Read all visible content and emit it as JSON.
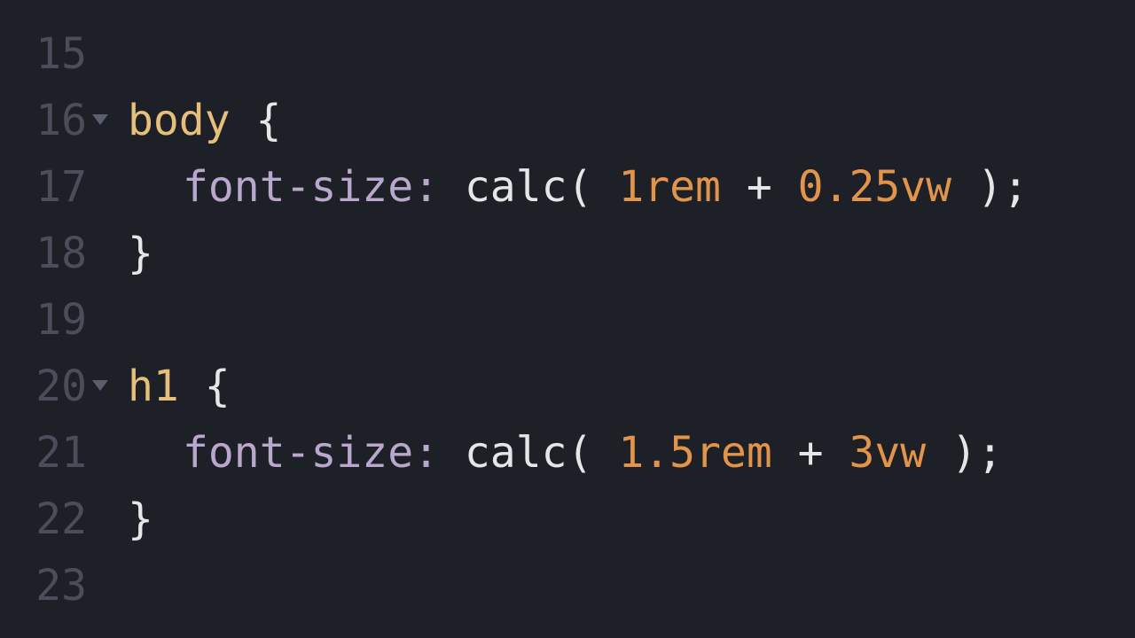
{
  "editor": {
    "language": "css",
    "lines": [
      {
        "num": "15",
        "foldable": false,
        "indent": 0,
        "tokens": []
      },
      {
        "num": "16",
        "foldable": true,
        "indent": 0,
        "tokens": [
          {
            "t": "selector",
            "v": "body"
          },
          {
            "t": "space",
            "v": " "
          },
          {
            "t": "brace",
            "v": "{"
          }
        ]
      },
      {
        "num": "17",
        "foldable": false,
        "indent": 1,
        "tokens": [
          {
            "t": "property",
            "v": "font-size"
          },
          {
            "t": "colon",
            "v": ":"
          },
          {
            "t": "space",
            "v": " "
          },
          {
            "t": "func",
            "v": "calc"
          },
          {
            "t": "paren",
            "v": "("
          },
          {
            "t": "space",
            "v": " "
          },
          {
            "t": "number",
            "v": "1"
          },
          {
            "t": "unit",
            "v": "rem"
          },
          {
            "t": "space",
            "v": " "
          },
          {
            "t": "op",
            "v": "+"
          },
          {
            "t": "space",
            "v": " "
          },
          {
            "t": "number",
            "v": "0.25"
          },
          {
            "t": "unit",
            "v": "vw"
          },
          {
            "t": "space",
            "v": " "
          },
          {
            "t": "paren",
            "v": ")"
          },
          {
            "t": "semi",
            "v": ";"
          }
        ]
      },
      {
        "num": "18",
        "foldable": false,
        "indent": 0,
        "tokens": [
          {
            "t": "brace",
            "v": "}"
          }
        ]
      },
      {
        "num": "19",
        "foldable": false,
        "indent": 0,
        "tokens": []
      },
      {
        "num": "20",
        "foldable": true,
        "indent": 0,
        "tokens": [
          {
            "t": "selector",
            "v": "h1"
          },
          {
            "t": "space",
            "v": " "
          },
          {
            "t": "brace",
            "v": "{"
          }
        ]
      },
      {
        "num": "21",
        "foldable": false,
        "indent": 1,
        "tokens": [
          {
            "t": "property",
            "v": "font-size"
          },
          {
            "t": "colon",
            "v": ":"
          },
          {
            "t": "space",
            "v": " "
          },
          {
            "t": "func",
            "v": "calc"
          },
          {
            "t": "paren",
            "v": "("
          },
          {
            "t": "space",
            "v": " "
          },
          {
            "t": "number",
            "v": "1.5"
          },
          {
            "t": "unit",
            "v": "rem"
          },
          {
            "t": "space",
            "v": " "
          },
          {
            "t": "op",
            "v": "+"
          },
          {
            "t": "space",
            "v": " "
          },
          {
            "t": "number",
            "v": "3"
          },
          {
            "t": "unit",
            "v": "vw"
          },
          {
            "t": "space",
            "v": " "
          },
          {
            "t": "paren",
            "v": ")"
          },
          {
            "t": "semi",
            "v": ";"
          }
        ]
      },
      {
        "num": "22",
        "foldable": false,
        "indent": 0,
        "tokens": [
          {
            "t": "brace",
            "v": "}"
          }
        ]
      },
      {
        "num": "23",
        "foldable": false,
        "indent": 0,
        "tokens": []
      }
    ]
  },
  "colors": {
    "background": "#1e2028",
    "gutter": "#4b4e5a",
    "selector": "#e6c07b",
    "property": "#b9a7cc",
    "number": "#e2954a",
    "default": "#e6e6e6"
  }
}
